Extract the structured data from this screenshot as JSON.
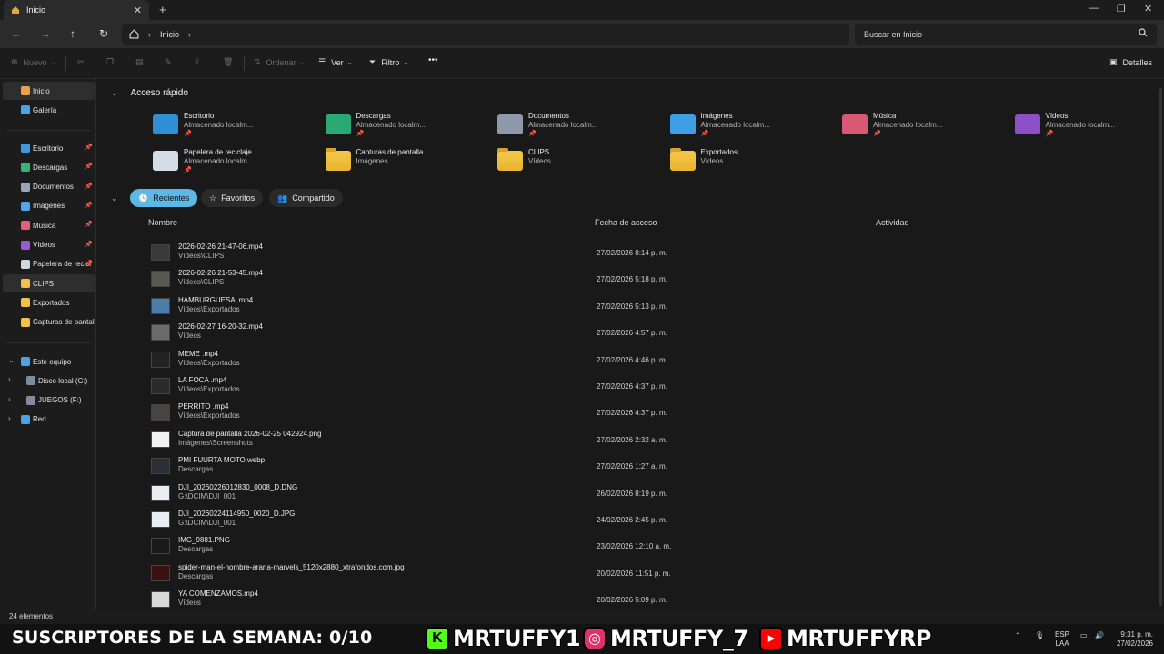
{
  "window": {
    "tab_title": "Inicio",
    "tab_icon": "home-icon",
    "new_tab": "+",
    "close_tab": "✕",
    "minimize": "—",
    "maximize": "❐",
    "close": "✕"
  },
  "address": {
    "crumbs": [
      "Inicio"
    ],
    "separator": "›",
    "search_placeholder": "Buscar en Inicio"
  },
  "toolbar": {
    "new_label": "Nuevo",
    "sort_label": "Ordenar",
    "view_label": "Ver",
    "filter_label": "Filtro",
    "more_label": "•••",
    "details_label": "Detalles"
  },
  "sidebar": {
    "top": [
      {
        "label": "Inicio",
        "icon": "home-icon",
        "color": "#e8a24a"
      },
      {
        "label": "Galería",
        "icon": "gallery-icon",
        "color": "#4aa3e8"
      }
    ],
    "pinned": [
      {
        "label": "Escritorio",
        "icon": "desktop-icon",
        "color": "#3c9be0"
      },
      {
        "label": "Descargas",
        "icon": "downloads-icon",
        "color": "#35b37e"
      },
      {
        "label": "Documentos",
        "icon": "documents-icon",
        "color": "#9aa6b8"
      },
      {
        "label": "Imágenes",
        "icon": "pictures-icon",
        "color": "#4fa6e8"
      },
      {
        "label": "Música",
        "icon": "music-icon",
        "color": "#e0607a"
      },
      {
        "label": "Vídeos",
        "icon": "videos-icon",
        "color": "#9b59d0"
      },
      {
        "label": "Papelera de recicl",
        "icon": "recycle-bin-icon",
        "color": "#cfd8e0"
      }
    ],
    "folders": [
      {
        "label": "CLIPS",
        "icon": "folder-icon",
        "color": "#f2c14a"
      },
      {
        "label": "Exportados",
        "icon": "folder-icon",
        "color": "#f2c14a"
      },
      {
        "label": "Capturas de pantall",
        "icon": "folder-icon",
        "color": "#f2c14a"
      }
    ],
    "tree": [
      {
        "label": "Este equipo",
        "icon": "computer-icon",
        "color": "#4aa3e8",
        "indent": 0,
        "expander": "⌄"
      },
      {
        "label": "Disco local (C:)",
        "icon": "drive-icon",
        "color": "#7f8c9a",
        "indent": 1,
        "expander": "›"
      },
      {
        "label": "JUEGOS (F:)",
        "icon": "drive-icon",
        "color": "#7f8c9a",
        "indent": 1,
        "expander": "›"
      },
      {
        "label": "Red",
        "icon": "network-icon",
        "color": "#4aa3e8",
        "indent": 0,
        "expander": "›"
      }
    ]
  },
  "quick_access": {
    "title": "Acceso rápido",
    "items": [
      {
        "name": "Escritorio",
        "sub": "Almacenado localm...",
        "pinned": true,
        "icon": "desktop-icon",
        "color": "#2f8fd6"
      },
      {
        "name": "Descargas",
        "sub": "Almacenado localm...",
        "pinned": true,
        "icon": "downloads-icon",
        "color": "#2aa874"
      },
      {
        "name": "Documentos",
        "sub": "Almacenado localm...",
        "pinned": true,
        "icon": "documents-icon",
        "color": "#8d99ab"
      },
      {
        "name": "Imágenes",
        "sub": "Almacenado localm...",
        "pinned": true,
        "icon": "pictures-icon",
        "color": "#3f9fe6"
      },
      {
        "name": "Música",
        "sub": "Almacenado localm...",
        "pinned": true,
        "icon": "music-icon",
        "color": "#d95873"
      },
      {
        "name": "Vídeos",
        "sub": "Almacenado localm...",
        "pinned": true,
        "icon": "videos-icon",
        "color": "#8d4fc9"
      },
      {
        "name": "Papelera de reciclaje",
        "sub": "Almacenado localm...",
        "pinned": true,
        "icon": "recycle-bin-icon",
        "color": "#d4dde6"
      },
      {
        "name": "Capturas de pantalla",
        "sub": "Imágenes",
        "pinned": false,
        "icon": "folder-icon",
        "color": "#f2c14a"
      },
      {
        "name": "CLIPS",
        "sub": "Vídeos",
        "pinned": false,
        "icon": "folder-icon",
        "color": "#f2c14a"
      },
      {
        "name": "Exportados",
        "sub": "Vídeos",
        "pinned": false,
        "icon": "folder-icon",
        "color": "#f2c14a"
      }
    ]
  },
  "tabs": [
    {
      "label": "Recientes",
      "icon": "clock-icon",
      "active": true
    },
    {
      "label": "Favoritos",
      "icon": "star-icon",
      "active": false
    },
    {
      "label": "Compartido",
      "icon": "people-icon",
      "active": false
    }
  ],
  "columns": {
    "name": "Nombre",
    "date": "Fecha de acceso",
    "activity": "Actividad"
  },
  "files": [
    {
      "name": "2026-02-26 21-47-06.mp4",
      "path": "Vídeos\\CLIPS",
      "date": "27/02/2026 8:14 p. m.",
      "thumb": "#3a3a3a"
    },
    {
      "name": "2026-02-26 21-53-45.mp4",
      "path": "Vídeos\\CLIPS",
      "date": "27/02/2026 5:18 p. m.",
      "thumb": "#555b52"
    },
    {
      "name": "HAMBURGUESA .mp4",
      "path": "Vídeos\\Exportados",
      "date": "27/02/2026 5:13 p. m.",
      "thumb": "#4c7da8"
    },
    {
      "name": "2026-02-27 16-20-32.mp4",
      "path": "Vídeos",
      "date": "27/02/2026 4:57 p. m.",
      "thumb": "#6b6b6b"
    },
    {
      "name": "MEME .mp4",
      "path": "Vídeos\\Exportados",
      "date": "27/02/2026 4:46 p. m.",
      "thumb": "#222222"
    },
    {
      "name": "LA FOCA .mp4",
      "path": "Vídeos\\Exportados",
      "date": "27/02/2026 4:37 p. m.",
      "thumb": "#2a2a2a"
    },
    {
      "name": "PERRITO .mp4",
      "path": "Vídeos\\Exportados",
      "date": "27/02/2026 4:37 p. m.",
      "thumb": "#4a4440"
    },
    {
      "name": "Captura de pantalla 2026-02-25 042924.png",
      "path": "Imágenes\\Screenshots",
      "date": "27/02/2026 2:32 a. m.",
      "thumb": "#f2f2f2"
    },
    {
      "name": "PMI FUURTA MOTO.webp",
      "path": "Descargas",
      "date": "27/02/2026 1:27 a. m.",
      "thumb": "#2e2e38"
    },
    {
      "name": "DJI_20260226012830_0008_D.DNG",
      "path": "G:\\DCIM\\DJI_001",
      "date": "26/02/2026 8:19 p. m.",
      "thumb": "#e9eef4"
    },
    {
      "name": "DJI_20260224114950_0020_D.JPG",
      "path": "G:\\DCIM\\DJI_001",
      "date": "24/02/2026 2:45 p. m.",
      "thumb": "#e9eef4"
    },
    {
      "name": "IMG_9881.PNG",
      "path": "Descargas",
      "date": "23/02/2026 12:10 a. m.",
      "thumb": "#1a1a1a"
    },
    {
      "name": "spider-man-el-hombre-arana-marvels_5120x2880_xtrafondos.com.jpg",
      "path": "Descargas",
      "date": "20/02/2026 11:51 p. m.",
      "thumb": "#3a1010"
    },
    {
      "name": "YA COMENZAMOS.mp4",
      "path": "Vídeos",
      "date": "20/02/2026 5:09 p. m.",
      "thumb": "#d8d8d8"
    }
  ],
  "status": {
    "count": "24 elementos"
  },
  "overlay": {
    "subs_text": "SUSCRIPTORES DE LA SEMANA: 0/10",
    "kick": {
      "badge": "K",
      "handle": "MRTUFFY1",
      "color": "#53fc18"
    },
    "instagram": {
      "badge": "◎",
      "handle": "MRTUFFY_7",
      "color": "#e1306c"
    },
    "youtube": {
      "badge": "▶",
      "handle": "MRTUFFYRP",
      "color": "#ff0000"
    }
  },
  "taskbar": {
    "lang_top": "ESP",
    "lang_bottom": "LAA",
    "time": "9:31 p. m.",
    "date": "27/02/2026"
  }
}
